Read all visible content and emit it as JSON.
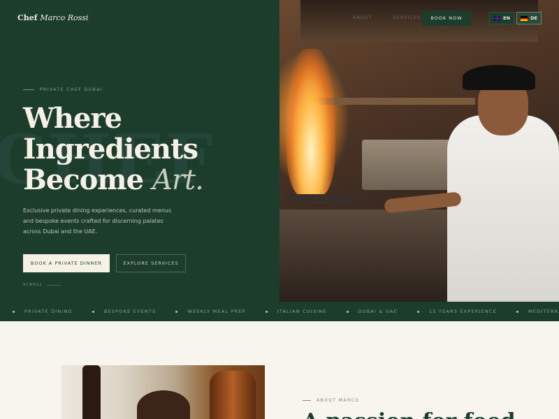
{
  "brand": {
    "prefix": "Chef",
    "name": "Marco Rossi"
  },
  "nav": {
    "links": [
      "ABOUT",
      "SERVICES"
    ],
    "book_label": "BOOK NOW",
    "languages": [
      {
        "code": "EN",
        "flag": "uk-flag-icon"
      },
      {
        "code": "DE",
        "flag": "germany-flag-icon"
      }
    ]
  },
  "hero": {
    "watermark": "CHEF",
    "eyebrow": "PRIVATE CHEF DUBAI",
    "headline": {
      "line1": "Where",
      "line2": "Ingredients",
      "line3_prefix": "Become ",
      "line3_accent": "Art."
    },
    "description": "Exclusive private dining experiences, curated menus and bespoke events crafted for discerning palates across Dubai and the UAE.",
    "primary_cta": "BOOK A PRIVATE DINNER",
    "secondary_cta": "EXPLORE SERVICES",
    "scroll_label": "SCROLL"
  },
  "ticker": [
    "PRIVATE DINING",
    "BESPOKE EVENTS",
    "WEEKLY MEAL PREP",
    "ITALIAN CUISINE",
    "DUBAI & UAE",
    "15 YEARS EXPERIENCE",
    "MEDITERRANEAN FLAVOURS"
  ],
  "about": {
    "eyebrow": "ABOUT MARCO",
    "heading": "A passion for food"
  },
  "colors": {
    "primary": "#1d3d2c",
    "cream": "#f6f1e5",
    "background": "#f8f5ef"
  }
}
